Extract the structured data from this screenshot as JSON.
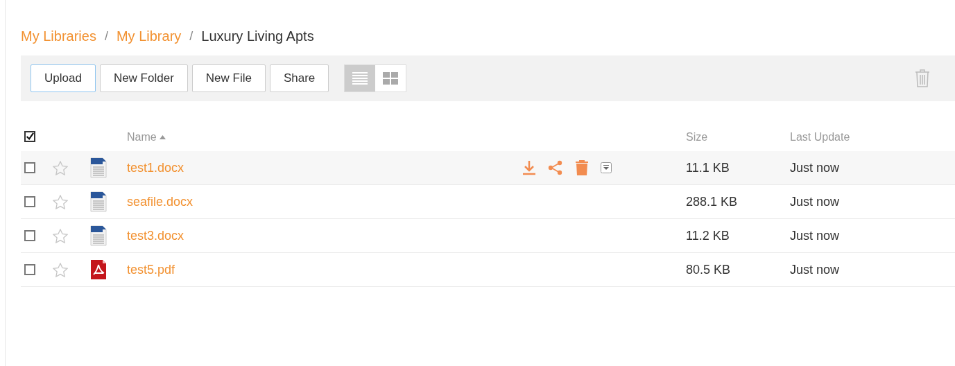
{
  "breadcrumb": [
    {
      "label": "My Libraries",
      "link": true
    },
    {
      "label": "My Library",
      "link": true
    },
    {
      "label": "Luxury Living Apts",
      "link": false
    }
  ],
  "breadcrumb_separator": "/",
  "toolbar": {
    "buttons": [
      {
        "label": "Upload",
        "focused": true
      },
      {
        "label": "New Folder",
        "focused": false
      },
      {
        "label": "New File",
        "focused": false
      },
      {
        "label": "Share",
        "focused": false
      }
    ],
    "views": [
      {
        "kind": "list",
        "selected": true
      },
      {
        "kind": "grid",
        "selected": false
      }
    ]
  },
  "table": {
    "select_all": {
      "checked": true
    },
    "columns": [
      {
        "label": "Name",
        "sorted": true
      },
      {
        "label": "Size",
        "sorted": false
      },
      {
        "label": "Last Update",
        "sorted": false
      }
    ],
    "rows": [
      {
        "name": "test1.docx",
        "kind": "docx",
        "size": "11.1 KB",
        "updated": "Just now",
        "checked": false,
        "starred": false,
        "hovered": true
      },
      {
        "name": "seafile.docx",
        "kind": "docx",
        "size": "288.1 KB",
        "updated": "Just now",
        "checked": false,
        "starred": false,
        "hovered": false
      },
      {
        "name": "test3.docx",
        "kind": "docx",
        "size": "11.2 KB",
        "updated": "Just now",
        "checked": false,
        "starred": false,
        "hovered": false
      },
      {
        "name": "test5.pdf",
        "kind": "pdf",
        "size": "80.5 KB",
        "updated": "Just now",
        "checked": false,
        "starred": false,
        "hovered": false
      }
    ]
  }
}
